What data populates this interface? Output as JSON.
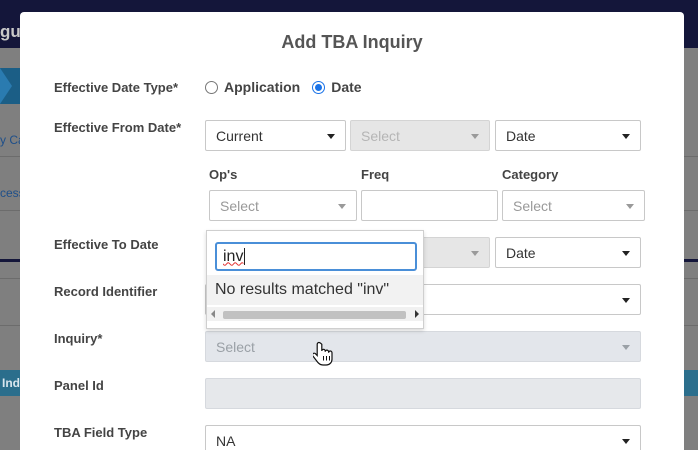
{
  "background": {
    "logo_fragment": "gu",
    "link1_fragment": "y Ca",
    "link2_fragment": "cess",
    "ind_fragment": "Ind"
  },
  "modal": {
    "title": "Add TBA Inquiry"
  },
  "form": {
    "effective_date_type": {
      "label": "Effective Date Type*",
      "options": [
        "Application",
        "Date"
      ],
      "selected": "Date"
    },
    "effective_from_date": {
      "label": "Effective From Date*",
      "select1": "Current",
      "select2_placeholder": "Select",
      "select3": "Date"
    },
    "sub_fields": {
      "ops_label": "Op's",
      "ops_placeholder": "Select",
      "freq_label": "Freq",
      "freq_value": "",
      "category_label": "Category",
      "category_placeholder": "Select"
    },
    "effective_to_date": {
      "label": "Effective To Date",
      "select3": "Date"
    },
    "record_identifier": {
      "label": "Record Identifier"
    },
    "inquiry": {
      "label": "Inquiry*",
      "placeholder": "Select"
    },
    "panel_id": {
      "label": "Panel Id",
      "value": ""
    },
    "tba_field_type": {
      "label": "TBA Field Type",
      "value": "NA"
    }
  },
  "dropdown": {
    "search_text": "inv",
    "no_results": "No results matched \"inv\""
  },
  "icons": {
    "caret": "caret-down-icon",
    "cursor": "hand-pointer-icon"
  }
}
